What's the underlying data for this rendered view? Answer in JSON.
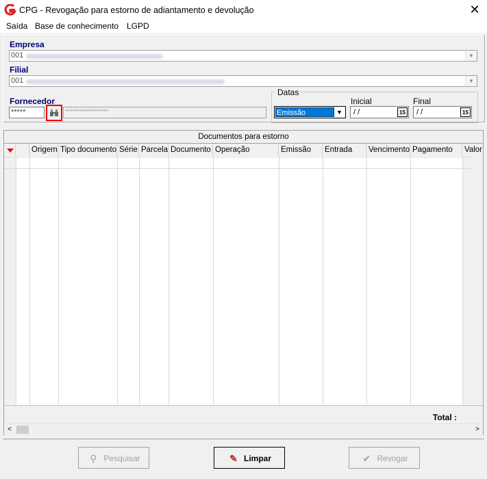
{
  "window": {
    "title": "CPG - Revogação para estorno de adiantamento e devolução",
    "close_label": "✕"
  },
  "menu": [
    "Saída",
    "Base de conhecimento",
    "LGPD"
  ],
  "form": {
    "empresa_label": "Empresa",
    "empresa_value": "001",
    "filial_label": "Filial",
    "filial_value": "001",
    "fornecedor_label": "Fornecedor",
    "fornecedor_code": "*****",
    "fornecedor_name": "******************"
  },
  "datas": {
    "group_label": "Datas",
    "type_value": "Emissão",
    "inicial_label": "Inicial",
    "inicial_value": " / /",
    "final_label": "Final",
    "final_value": " / /"
  },
  "grid": {
    "title": "Documentos para estorno",
    "columns": [
      "Origem",
      "Tipo documento",
      "Série",
      "Parcela",
      "Documento",
      "Operação",
      "Emissão",
      "Entrada",
      "Vencimento",
      "Pagamento",
      "Valor"
    ],
    "total_label": "Total :"
  },
  "buttons": {
    "pesquisar": "Pesquisar",
    "limpar": "Limpar",
    "revogar": "Revogar"
  }
}
